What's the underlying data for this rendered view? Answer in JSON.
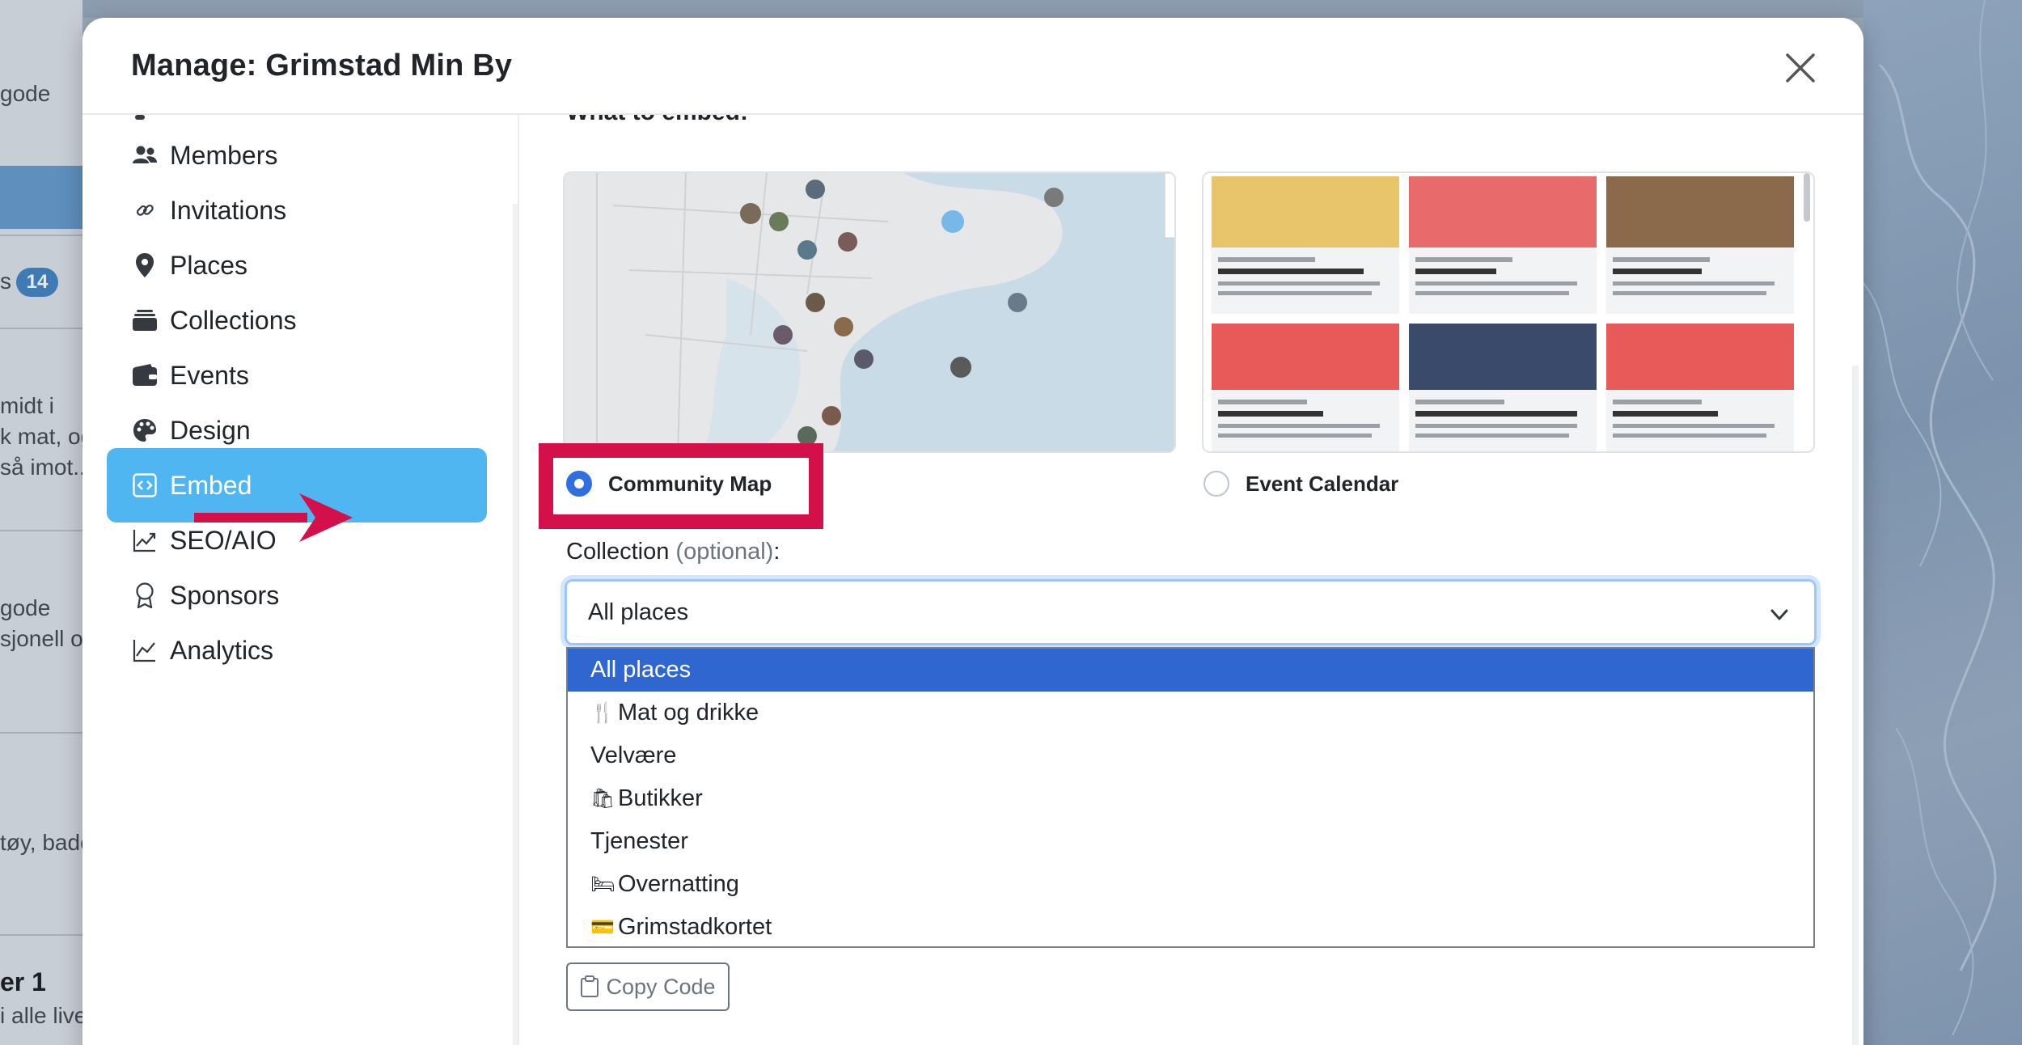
{
  "modal": {
    "title": "Manage: Grimstad Min By"
  },
  "sidebar": {
    "items": [
      {
        "label": "Members",
        "icon": "users-icon"
      },
      {
        "label": "Invitations",
        "icon": "link-icon"
      },
      {
        "label": "Places",
        "icon": "map-pin-icon"
      },
      {
        "label": "Collections",
        "icon": "collection-icon"
      },
      {
        "label": "Events",
        "icon": "wallet-icon"
      },
      {
        "label": "Design",
        "icon": "palette-icon"
      },
      {
        "label": "Embed",
        "icon": "code-icon",
        "active": true
      },
      {
        "label": "SEO/AIO",
        "icon": "graph-up-icon"
      },
      {
        "label": "Sponsors",
        "icon": "award-icon"
      },
      {
        "label": "Analytics",
        "icon": "graph-icon"
      }
    ]
  },
  "embed": {
    "heading": "What to embed:",
    "options": [
      {
        "label": "Community Map",
        "checked": true
      },
      {
        "label": "Event Calendar",
        "checked": false
      }
    ],
    "collection_label": "Collection",
    "collection_optional": "(optional)",
    "collection_colon": ":",
    "selected_value": "All places",
    "dropdown_options": [
      {
        "label": "All places",
        "emoji": "",
        "selected": true
      },
      {
        "label": "Mat og drikke",
        "emoji": "🍴",
        "selected": false
      },
      {
        "label": "Velvære",
        "emoji": "",
        "selected": false
      },
      {
        "label": "Butikker",
        "emoji": "🛍",
        "selected": false
      },
      {
        "label": "Tjenester",
        "emoji": "",
        "selected": false
      },
      {
        "label": "Overnatting",
        "emoji": "🛏",
        "selected": false
      },
      {
        "label": "Grimstadkortet",
        "emoji": "💳",
        "selected": false
      }
    ],
    "copy_button": "Copy Code"
  },
  "background": {
    "left_texts": [
      "gode",
      "s",
      "14",
      "midt i",
      "k mat, og",
      "så imot..",
      "gode",
      "sjonell og",
      "tøy, bade",
      "er 1",
      "i alle live"
    ]
  },
  "colors": {
    "accent": "#4fb6f2",
    "radio_checked": "#2f6fe0",
    "dropdown_selected": "#2f66d0",
    "highlight": "#d3104a"
  }
}
